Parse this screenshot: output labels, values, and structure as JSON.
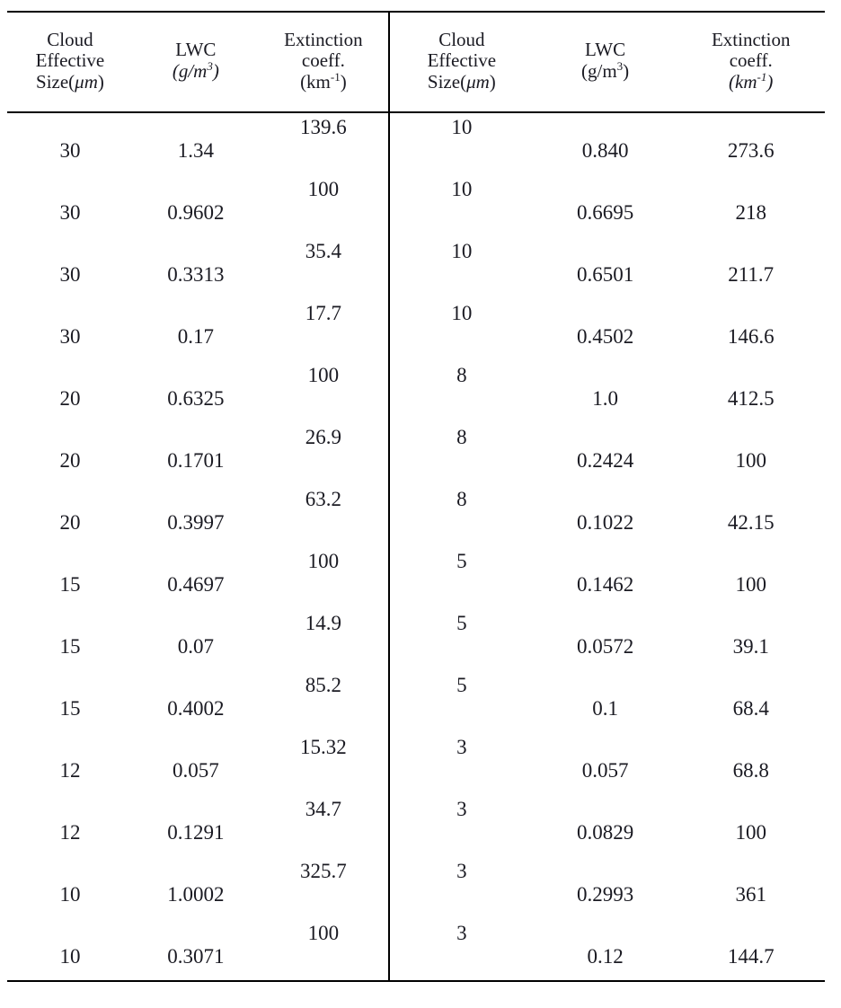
{
  "document": {
    "type": "data-table",
    "panel_count": 2,
    "row_count_per_panel": 14
  },
  "left_panel": {
    "headers": {
      "size": {
        "line1": "Cloud",
        "line2": "Effective",
        "line3_prefix": "Size(",
        "line3_unit": "μm",
        "line3_suffix": ")"
      },
      "lwc": {
        "line1": "LWC",
        "line2_prefix": "(",
        "line2_unit": "g/m",
        "line2_sup": "3",
        "line2_suffix": ")"
      },
      "ext": {
        "line1": "Extinction",
        "line2": "coeff.",
        "line3_prefix": "(km",
        "line3_sup": "-1",
        "line3_suffix": ")"
      }
    },
    "rows": [
      {
        "size": "30",
        "lwc": "1.34",
        "ext": "139.6"
      },
      {
        "size": "30",
        "lwc": "0.9602",
        "ext": "100"
      },
      {
        "size": "30",
        "lwc": "0.3313",
        "ext": "35.4"
      },
      {
        "size": "30",
        "lwc": "0.17",
        "ext": "17.7"
      },
      {
        "size": "20",
        "lwc": "0.6325",
        "ext": "100"
      },
      {
        "size": "20",
        "lwc": "0.1701",
        "ext": "26.9"
      },
      {
        "size": "20",
        "lwc": "0.3997",
        "ext": "63.2"
      },
      {
        "size": "15",
        "lwc": "0.4697",
        "ext": "100"
      },
      {
        "size": "15",
        "lwc": "0.07",
        "ext": "14.9"
      },
      {
        "size": "15",
        "lwc": "0.4002",
        "ext": "85.2"
      },
      {
        "size": "12",
        "lwc": "0.057",
        "ext": "15.32"
      },
      {
        "size": "12",
        "lwc": "0.1291",
        "ext": "34.7"
      },
      {
        "size": "10",
        "lwc": "1.0002",
        "ext": "325.7"
      },
      {
        "size": "10",
        "lwc": "0.3071",
        "ext": "100"
      }
    ]
  },
  "right_panel": {
    "headers": {
      "size": {
        "line1": "Cloud",
        "line2": "Effective",
        "line3_prefix": "Size(",
        "line3_unit": "μm",
        "line3_suffix": ")"
      },
      "lwc": {
        "line1": "LWC",
        "line2_prefix": "(",
        "line2_unit": "g/m",
        "line2_sup": "3",
        "line2_suffix": ")"
      },
      "ext": {
        "line1": "Extinction",
        "line2": "coeff.",
        "line3_prefix": "(km",
        "line3_sup": "-1",
        "line3_suffix": ")"
      }
    },
    "rows": [
      {
        "size": "10",
        "lwc": "0.840",
        "ext": "273.6"
      },
      {
        "size": "10",
        "lwc": "0.6695",
        "ext": "218"
      },
      {
        "size": "10",
        "lwc": "0.6501",
        "ext": "211.7"
      },
      {
        "size": "10",
        "lwc": "0.4502",
        "ext": "146.6"
      },
      {
        "size": "8",
        "lwc": "1.0",
        "ext": "412.5"
      },
      {
        "size": "8",
        "lwc": "0.2424",
        "ext": "100"
      },
      {
        "size": "8",
        "lwc": "0.1022",
        "ext": "42.15"
      },
      {
        "size": "5",
        "lwc": "0.1462",
        "ext": "100"
      },
      {
        "size": "5",
        "lwc": "0.0572",
        "ext": "39.1"
      },
      {
        "size": "5",
        "lwc": "0.1",
        "ext": "68.4"
      },
      {
        "size": "3",
        "lwc": "0.057",
        "ext": "68.8"
      },
      {
        "size": "3",
        "lwc": "0.0829",
        "ext": "100"
      },
      {
        "size": "3",
        "lwc": "0.2993",
        "ext": "361"
      },
      {
        "size": "3",
        "lwc": "0.12",
        "ext": "144.7"
      }
    ]
  }
}
